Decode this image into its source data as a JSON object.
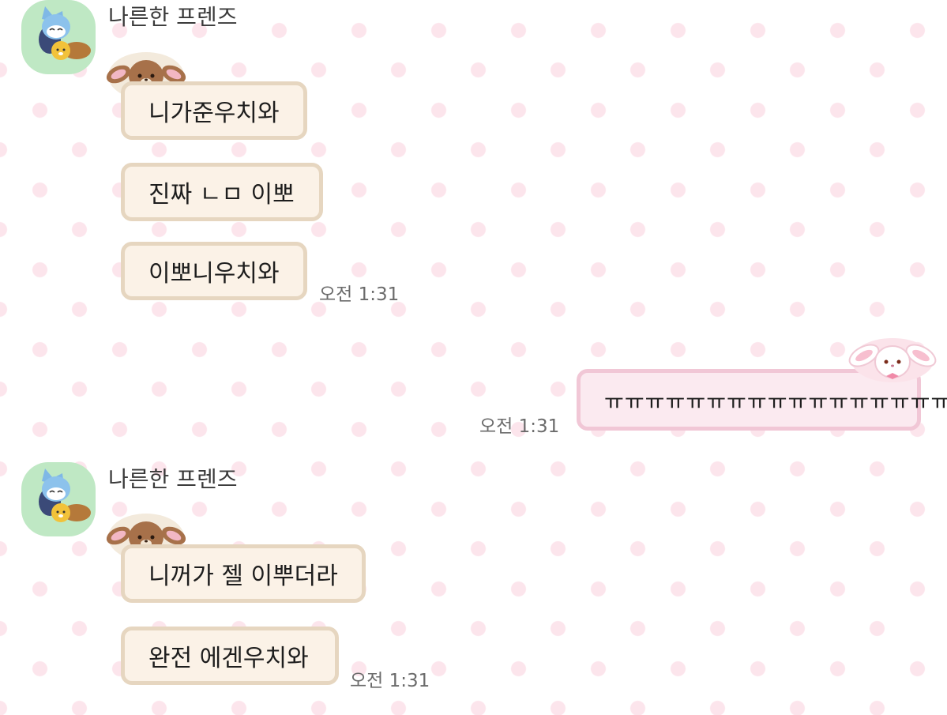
{
  "messages": [
    {
      "sender": "나른한 프렌즈",
      "bubbles": [
        "니가준우치와",
        "진짜 ㄴㅁ 이뽀",
        "이뽀니우치와"
      ],
      "time": "오전 1:31"
    },
    {
      "mine": true,
      "bubbles": [
        "ㅠㅠㅠㅠㅠㅠㅠㅠㅠㅠㅠㅠㅠㅠㅠㅠㅠㅠ"
      ],
      "time": "오전 1:31"
    },
    {
      "sender": "나른한 프렌즈",
      "bubbles": [
        "니꺼가 젤 이뿌더라",
        "완전 에겐우치와"
      ],
      "time": "오전 1:31"
    }
  ],
  "icons": {
    "avatar": "friend-avatar-icon",
    "brown_bunny": "brown-bunny-sticker-icon",
    "white_bunny": "white-bunny-sticker-icon"
  },
  "colors": {
    "bubble_in": "#fbf2e7",
    "bubble_in_border": "#e6d6c0",
    "bubble_out": "#fbeaf0",
    "bubble_out_border": "#f1c7d6",
    "dot": "#fce5ec"
  }
}
